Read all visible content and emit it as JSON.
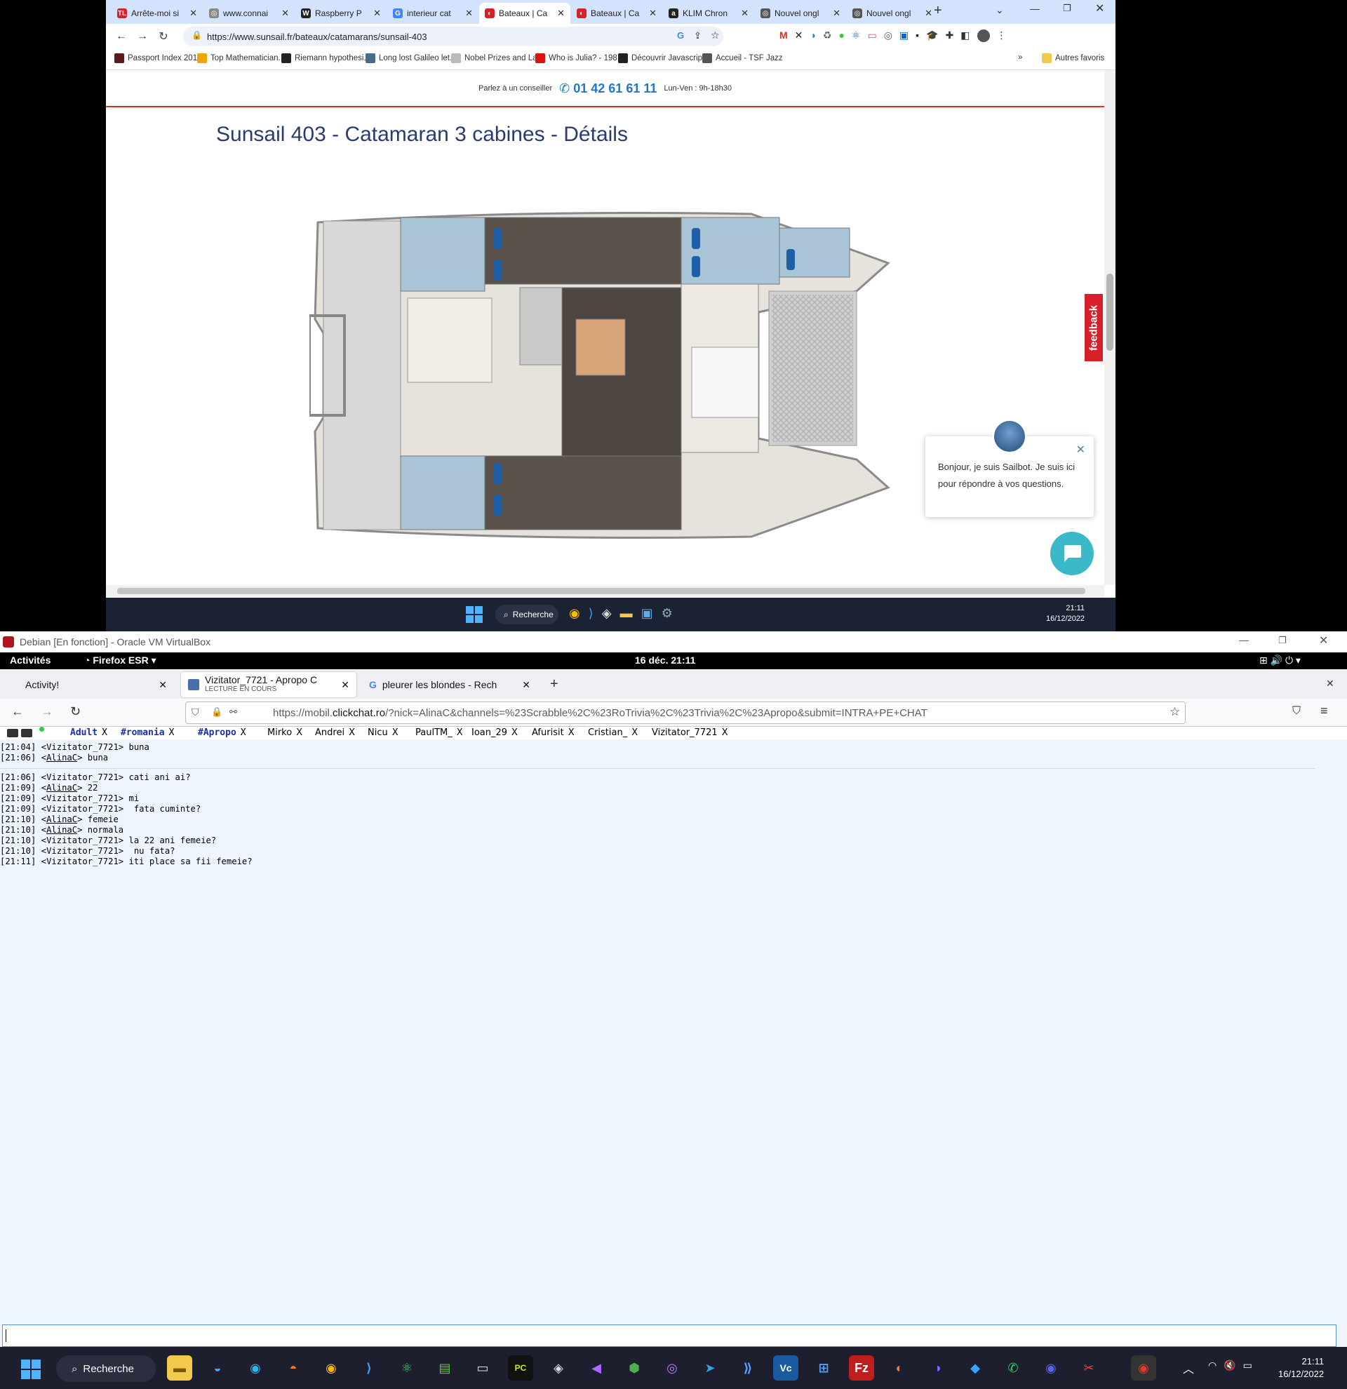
{
  "chrome": {
    "tabs": [
      {
        "title": "Arrête-moi si",
        "icon": "tl-icon",
        "color": "#d6202a",
        "glyph": "TL"
      },
      {
        "title": "www.connai",
        "icon": "globe-icon",
        "color": "#888888",
        "glyph": "◎"
      },
      {
        "title": "Raspberry P",
        "icon": "wikipedia-icon",
        "color": "#222222",
        "glyph": "W"
      },
      {
        "title": "interieur cat",
        "icon": "google-icon",
        "color": "#4285f4",
        "glyph": "G"
      },
      {
        "title": "Bateaux | Ca",
        "icon": "sunsail-icon",
        "color": "#d6202a",
        "glyph": "◐"
      },
      {
        "title": "Bateaux | Ca",
        "icon": "sunsail-icon",
        "color": "#d6202a",
        "glyph": "◐"
      },
      {
        "title": "KLIM Chron",
        "icon": "amazon-icon",
        "color": "#222222",
        "glyph": "a"
      },
      {
        "title": "Nouvel ongl",
        "icon": "globe-icon",
        "color": "#555555",
        "glyph": "◎"
      },
      {
        "title": "Nouvel ongl",
        "icon": "globe-icon",
        "color": "#555555",
        "glyph": "◎"
      }
    ],
    "url_prefix": "https://",
    "url_host": "www.sunsail.fr",
    "url_path": "/bateaux/catamarans/sunsail-403",
    "bookmarks": [
      {
        "label": "Passport Index 201...",
        "color": "#5a1a1a"
      },
      {
        "label": "Top Mathematician...",
        "color": "#f0a500"
      },
      {
        "label": "Riemann hypothesi...",
        "color": "#222222"
      },
      {
        "label": "Long lost Galileo let...",
        "color": "#4a6a8a"
      },
      {
        "label": "Nobel Prizes and La...",
        "color": "#bbbbbb"
      },
      {
        "label": "Who is Julia? - 198...",
        "color": "#e01010"
      },
      {
        "label": "Découvrir Javascrip...",
        "color": "#222222"
      },
      {
        "label": "Accueil - TSF Jazz",
        "color": "#555555"
      }
    ],
    "more_bookmarks": "»",
    "other_bookmarks": "Autres favoris"
  },
  "page": {
    "contact_label": "Parlez à un conseiller",
    "phone": "01 42 61 61 11",
    "hours": "Lun-Ven : 9h-18h30",
    "title": "Sunsail 403 - Catamaran 3 cabines - Détails",
    "feedback": "feedback",
    "bot_text": "Bonjour, je suis Sailbot. Je suis ici pour répondre à vos questions."
  },
  "host_taskbar": {
    "search": "Recherche",
    "time": "21:11",
    "date": "16/12/2022"
  },
  "vbox": {
    "window_title": "Debian [En fonction] - Oracle VM VirtualBox",
    "activities": "Activités",
    "app": "Firefox ESR",
    "clock": "16 déc.  21:11"
  },
  "firefox": {
    "tab1": "Activity!",
    "tab2_title": "Vizitator_7721 - Apropo C",
    "tab2_sub": "LECTURE EN COURS",
    "tab3": "pleurer les blondes - Rech",
    "url_prefix": "https://mobil.",
    "url_domain": "clickchat.ro",
    "url_rest": "/?nick=AlinaC&channels=%23Scrabble%2C%23RoTrivia%2C%23Trivia%2C%23Apropo&submit=INTRA+PE+CHAT"
  },
  "chat": {
    "channels": [
      {
        "label": "Adult",
        "bold": true
      },
      {
        "label": "#romania",
        "bold": true
      },
      {
        "label": "#Apropo",
        "bold": true
      },
      {
        "label": "Mirko",
        "bold": false
      },
      {
        "label": "Andrei",
        "bold": false
      },
      {
        "label": "Nicu",
        "bold": false
      },
      {
        "label": "PaulTM_",
        "bold": false
      },
      {
        "label": "Ioan_29",
        "bold": false
      },
      {
        "label": "Afurisit",
        "bold": false
      },
      {
        "label": "Cristian_",
        "bold": false
      },
      {
        "label": "Vizitator_7721",
        "bold": false
      }
    ],
    "lines": [
      {
        "time": "[21:04]",
        "nick": "Vizitator_7721",
        "me": false,
        "text": " buna"
      },
      {
        "time": "[21:06]",
        "nick": "AlinaC",
        "me": true,
        "text": " buna"
      },
      {
        "gap": true
      },
      {
        "time": "[21:06]",
        "nick": "Vizitator_7721",
        "me": false,
        "text": " cati ani ai?"
      },
      {
        "time": "[21:09]",
        "nick": "AlinaC",
        "me": true,
        "text": " 22"
      },
      {
        "time": "[21:09]",
        "nick": "Vizitator_7721",
        "me": false,
        "text": " mi"
      },
      {
        "time": "[21:09]",
        "nick": "Vizitator_7721",
        "me": false,
        "text": "  fata cuminte?"
      },
      {
        "time": "[21:10]",
        "nick": "AlinaC",
        "me": true,
        "text": " femeie"
      },
      {
        "time": "[21:10]",
        "nick": "AlinaC",
        "me": true,
        "text": " normala"
      },
      {
        "time": "[21:10]",
        "nick": "Vizitator_7721",
        "me": false,
        "text": " la 22 ani femeie?"
      },
      {
        "time": "[21:10]",
        "nick": "Vizitator_7721",
        "me": false,
        "text": "  nu fata?"
      },
      {
        "time": "[21:11]",
        "nick": "Vizitator_7721",
        "me": false,
        "text": " iti place sa fii femeie?"
      }
    ]
  },
  "taskbar": {
    "search": "Recherche",
    "time": "21:11",
    "date": "16/12/2022"
  }
}
